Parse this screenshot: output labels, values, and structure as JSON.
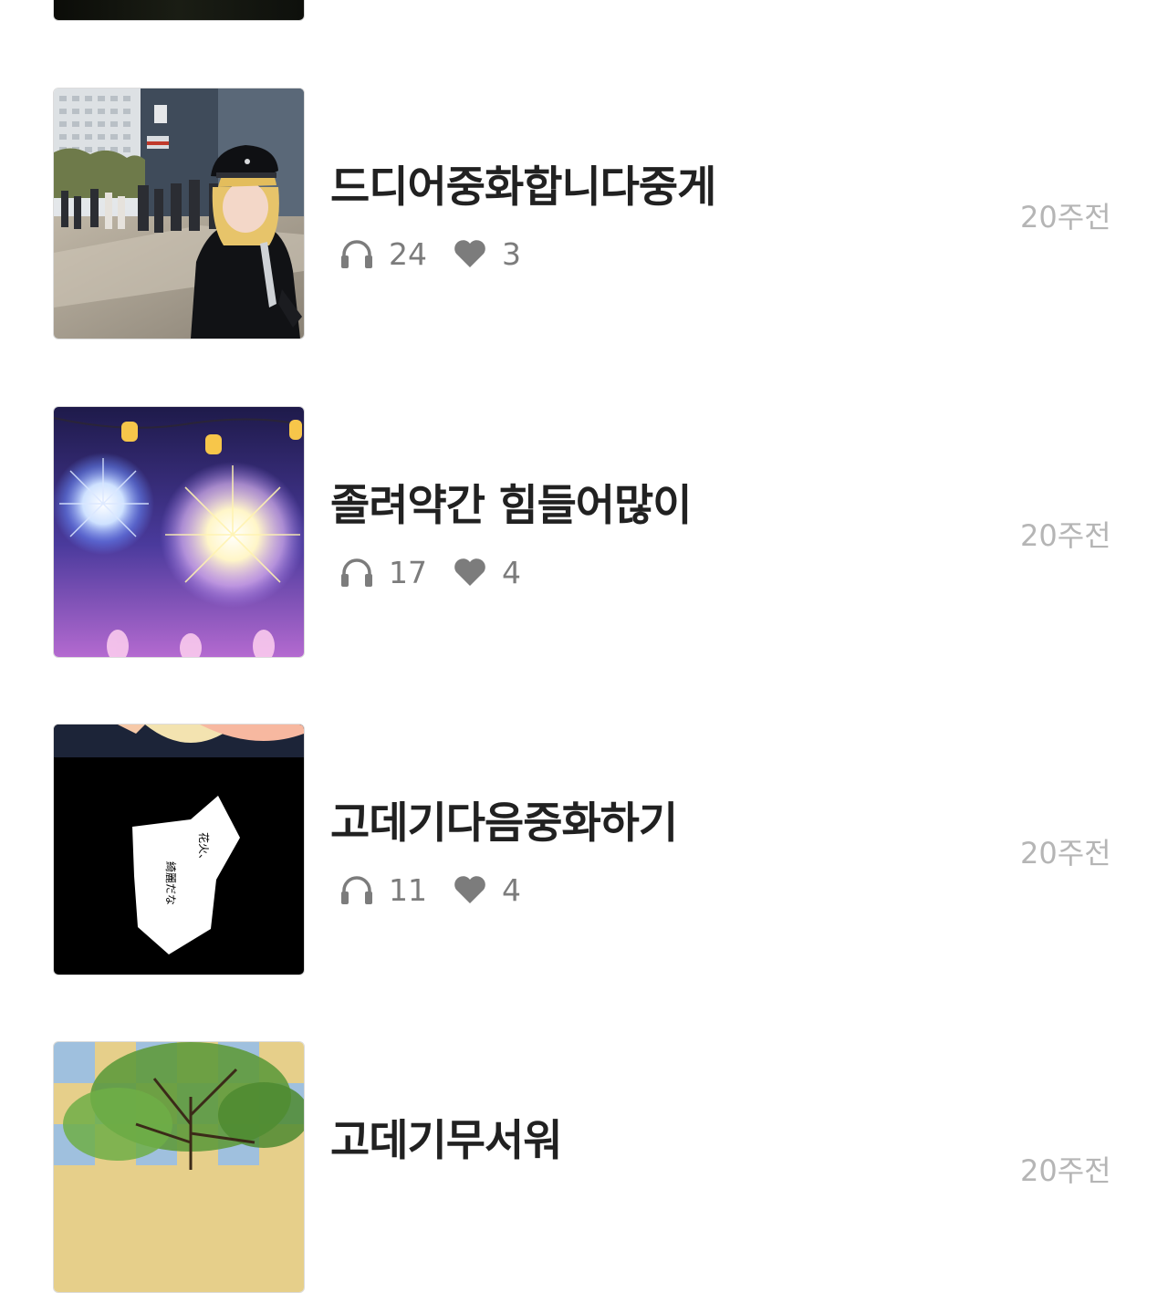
{
  "posts": [
    {
      "title": "드디어중화합니다중게",
      "plays": "24",
      "likes": "3",
      "time_ago": "20주전",
      "thumbnail": "cosplay-photo"
    },
    {
      "title": "졸려약간 힘들어많이",
      "plays": "17",
      "likes": "4",
      "time_ago": "20주전",
      "thumbnail": "fireworks-illustration"
    },
    {
      "title": "고데기다음중화하기",
      "plays": "11",
      "likes": "4",
      "time_ago": "20주전",
      "thumbnail": "manga-panel"
    },
    {
      "title": "고데기무서워",
      "plays": "",
      "likes": "",
      "time_ago": "20주전",
      "thumbnail": "tree-collage"
    }
  ],
  "manga_panel_text": [
    "花火、",
    "綺麗だな"
  ],
  "icons": {
    "plays": "headphones-icon",
    "likes": "heart-icon"
  },
  "colors": {
    "title": "#212121",
    "stats": "#7c7c7c",
    "time": "#b5b5b5",
    "background": "#ffffff"
  }
}
